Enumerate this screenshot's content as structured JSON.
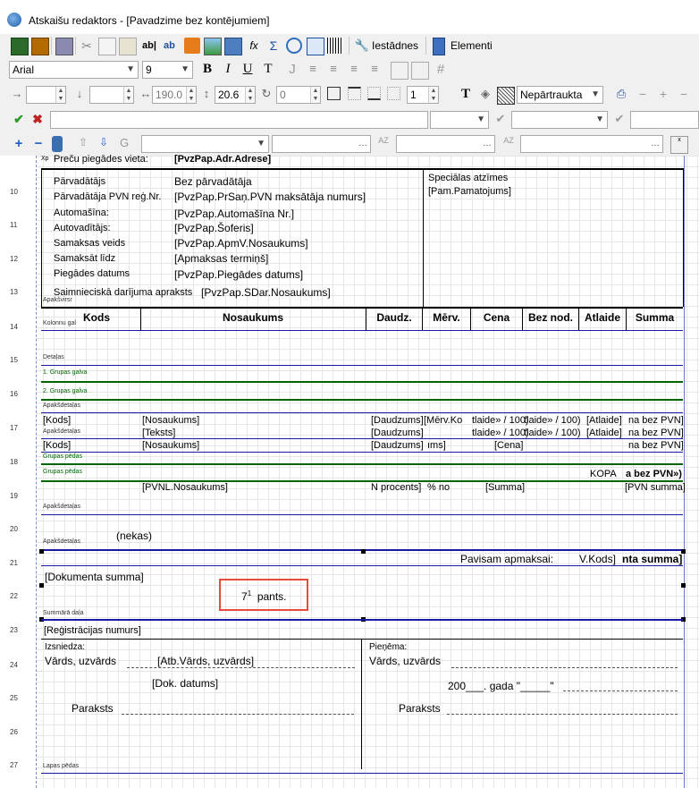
{
  "window": {
    "title": "Atskaišu redaktors - [Pavadzime bez kontējumiem]"
  },
  "toolbar1": {
    "settings_label": "Iestādnes",
    "elements_label": "Elementi"
  },
  "toolbar2": {
    "font_name": "Arial",
    "font_size": "9"
  },
  "toolbar3": {
    "left_value": "",
    "top_value": "",
    "width_value": "190.0",
    "height_value": "20.6",
    "rotation_value": "0",
    "tab_value": "1",
    "border_style": "Nepārtraukta"
  },
  "ruler": {
    "rows": [
      "10",
      "11",
      "12",
      "13",
      "14",
      "15",
      "16",
      "17",
      "18",
      "19",
      "20",
      "21",
      "22",
      "23",
      "24",
      "25",
      "26",
      "27"
    ]
  },
  "bands": {
    "apaksvirsraksts": "Apakšvirsr",
    "kolonnu_galva": "Kolonnu gal",
    "detalas": "Detaļas",
    "grupas_galva_1": "1. Grupas galva",
    "grupas_galva_2": "2. Grupas galva",
    "apaksdetalas_1": "Apakšdetaļas",
    "apaksdetalas_2": "Apakšdetaļas",
    "grupas_pedas_1": "Grupas pēdas",
    "grupas_pedas_2": "Grupas pēdas",
    "apaksdetalas_3": "Apakšdetaļas",
    "apaksdetalas_4": "Apakšdetaļas",
    "summara_dala": "Summārā daļa",
    "lapas_pedas": "Lapas pēdas",
    "top_cut": "Xp"
  },
  "report": {
    "top_label": "Preču piegādes vieta:",
    "top_value": "[PvzPap.Adr.Adrese]",
    "rows": [
      {
        "label": "Pārvadātājs",
        "value": "Bez pārvadātāja"
      },
      {
        "label": "Pārvadātāja PVN reģ.Nr.",
        "value": "[PvzPap.PrSaņ.PVN maksātāja numurs]"
      },
      {
        "label": "Automašīna:",
        "value": "[PvzPap.Automašīna Nr.]"
      },
      {
        "label": "Autovadītājs:",
        "value": "[PvzPap.Šoferis]"
      },
      {
        "label": "Samaksas veids",
        "value": "[PvzPap.ApmV.Nosaukums]"
      },
      {
        "label": "Samaksāt līdz",
        "value": "[Apmaksas termiņš]"
      },
      {
        "label": "Piegādes datums",
        "value": "[PvzPap.Piegādes datums]"
      },
      {
        "label": "Saimnieciskā darījuma apraksts",
        "value": "[PvzPap.SDar.Nosaukums]"
      }
    ],
    "special_title": "Speciālas atzīmes",
    "special_value": "[Pam.Pamatojums]",
    "columns": [
      "Kods",
      "Nosaukums",
      "Daudz.",
      "Mērv.",
      "Cena",
      "Bez nod.",
      "Atlaide",
      "Summa"
    ],
    "detail1": [
      "[Kods]",
      "[Nosaukums]",
      "[Daudzums]",
      "[Mērv.Ko",
      "tlaide» / 100)",
      "tlaide» / 100)",
      "[Atlaide]",
      "na bez PVN]"
    ],
    "detail2": [
      "[Teksts]",
      "[Daudzums]",
      "tlaide» / 100)",
      "tlaide» / 100)",
      "[Atlaide]",
      "na bez PVN]"
    ],
    "detail3": [
      "[Kods]",
      "[Nosaukums]",
      "[Daudzums]",
      "ıms]",
      "[Cena]",
      "na bez PVN]"
    ],
    "kopa_label": "KOPA",
    "kopa_value": "a bez PVN»)",
    "pvn_row": [
      "[PVNL.Nosaukums]",
      "N procents]",
      "% no",
      "[Summa]",
      "[PVN summa]"
    ],
    "nekas": "(nekas)",
    "pavisam_label": "Pavisam apmaksai:",
    "pavisam_kods": "V.Kods]",
    "pavisam_summa": "nta summa]",
    "dokumenta_summa": "[Dokumenta summa]",
    "pants_num": "7",
    "pants_sup": "1",
    "pants_text": "pants.",
    "registracijas": "[Reģistrācijas numurs]",
    "izsniedza": "Izsniedza:",
    "pienema": "Pieņēma:",
    "vards1": "Vārds, uzvārds",
    "atb_vards": "[Atb.Vārds, uzvārds]",
    "vards2": "Vārds, uzvārds",
    "dok_datums": "[Dok. datums]",
    "gada": "200___. gada \"_____\"",
    "paraksts1": "Paraksts",
    "paraksts2": "Paraksts"
  },
  "colors": {
    "band_line": "#00008b",
    "group_line": "#006400",
    "highlight": "#e84b3c"
  }
}
